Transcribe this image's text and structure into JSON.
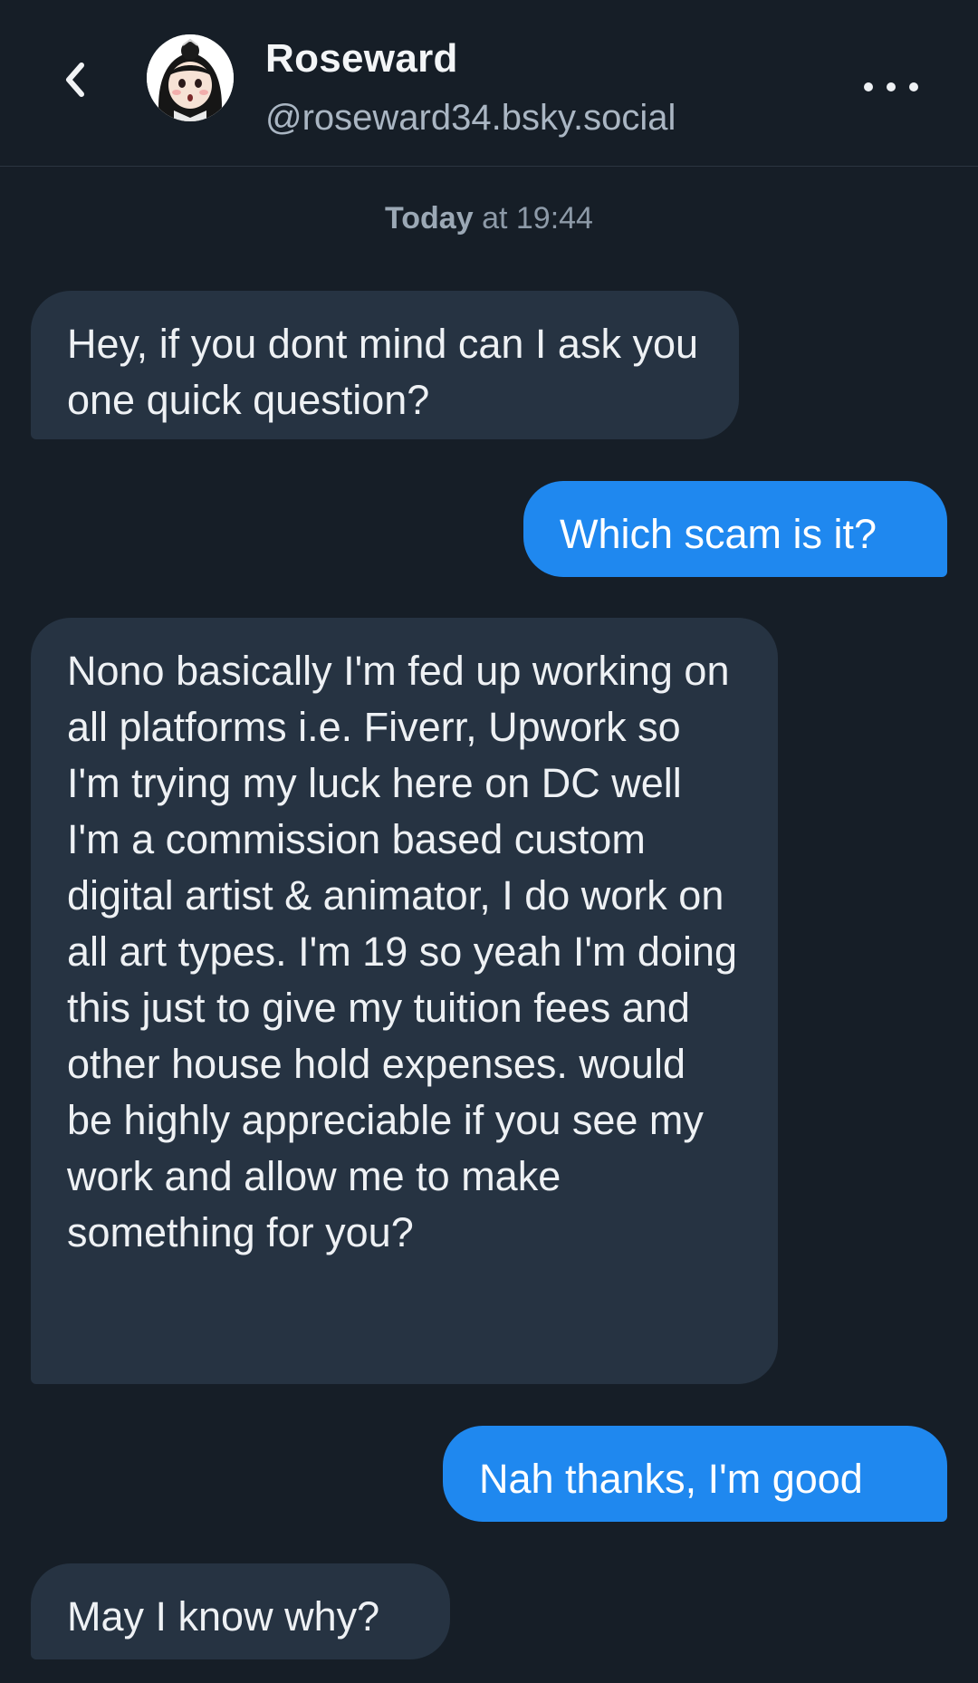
{
  "header": {
    "back_icon": "chevron-left-icon",
    "name": "Roseward",
    "handle": "@roseward34.bsky.social",
    "more_icon": "more-horizontal-icon"
  },
  "timestamp": {
    "day": "Today",
    "rest": " at 19:44"
  },
  "messages": [
    {
      "from": "them",
      "text": "Hey, if you dont mind can I ask you one quick question?"
    },
    {
      "from": "me",
      "text": "Which scam is it?"
    },
    {
      "from": "them",
      "text": "Nono basically I'm fed up working on all platforms i.e. Fiverr, Upwork so I'm trying my luck here on DC well I'm a commission based custom digital artist & animator, I do work on all art types. I'm 19 so yeah I'm doing this just to give my tuition fees and other house hold expenses. would be highly appreciable if you see my work and allow me to make something for you?"
    },
    {
      "from": "me",
      "text": "Nah thanks, I'm good"
    },
    {
      "from": "them",
      "text": "May I know why?"
    }
  ],
  "colors": {
    "background": "#161e27",
    "incoming_bubble": "#263342",
    "outgoing_bubble": "#1f88ef"
  }
}
